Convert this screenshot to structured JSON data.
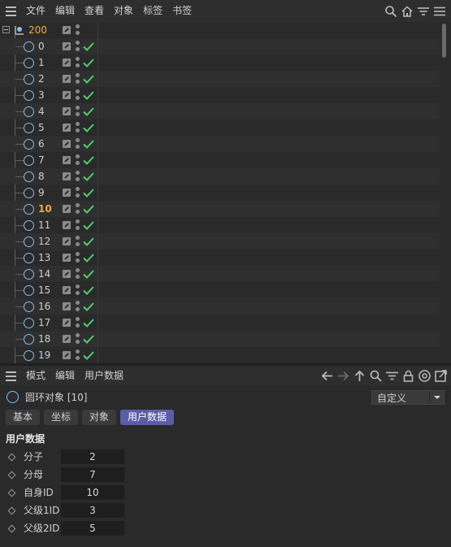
{
  "menubar": {
    "items": [
      "文件",
      "编辑",
      "查看",
      "对象",
      "标签",
      "书签"
    ],
    "icons": [
      "search-icon",
      "home-icon",
      "filter-icon",
      "menu-icon"
    ]
  },
  "tree": {
    "root": {
      "label": "200"
    },
    "children": [
      {
        "label": "0"
      },
      {
        "label": "1"
      },
      {
        "label": "2"
      },
      {
        "label": "3"
      },
      {
        "label": "4"
      },
      {
        "label": "5"
      },
      {
        "label": "6"
      },
      {
        "label": "7"
      },
      {
        "label": "8"
      },
      {
        "label": "9"
      },
      {
        "label": "10",
        "highlighted": true
      },
      {
        "label": "11"
      },
      {
        "label": "12"
      },
      {
        "label": "13"
      },
      {
        "label": "14"
      },
      {
        "label": "15"
      },
      {
        "label": "16"
      },
      {
        "label": "17"
      },
      {
        "label": "18"
      },
      {
        "label": "19"
      }
    ]
  },
  "attributes": {
    "menu": [
      "模式",
      "编辑",
      "用户数据"
    ],
    "object_title": "圆环对象 [10]",
    "preset": "自定义",
    "tabs": [
      "基本",
      "坐标",
      "对象",
      "用户数据"
    ],
    "active_tab": 3,
    "group_title": "用户数据",
    "fields": [
      {
        "label": "分子",
        "value": "2"
      },
      {
        "label": "分母",
        "value": "7"
      },
      {
        "label": "自身ID",
        "value": "10"
      },
      {
        "label": "父级1ID",
        "value": "3"
      },
      {
        "label": "父级2ID",
        "value": "5"
      }
    ]
  },
  "colors": {
    "accent_tab": "#5a5ea8",
    "highlight_text": "#f2a93b",
    "check_green": "#4fd16b",
    "circle_blue": "#7fc1ee"
  }
}
